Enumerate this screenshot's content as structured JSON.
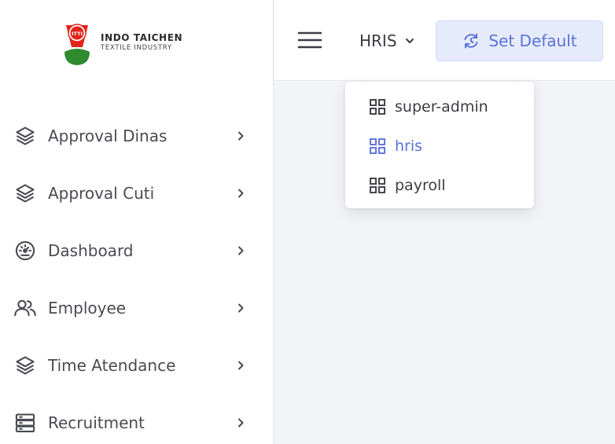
{
  "brand": {
    "name": "INDO TAICHEN",
    "subtitle": "TEXTILE INDUSTRY",
    "badge": "ITTI"
  },
  "sidebar": {
    "items": [
      {
        "label": "Approval Dinas",
        "icon": "layers-icon"
      },
      {
        "label": "Approval Cuti",
        "icon": "layers-icon"
      },
      {
        "label": "Dashboard",
        "icon": "gauge-icon"
      },
      {
        "label": "Employee",
        "icon": "users-icon"
      },
      {
        "label": "Time Atendance",
        "icon": "layers-icon"
      },
      {
        "label": "Recruitment",
        "icon": "server-icon"
      }
    ]
  },
  "header": {
    "module_select": "HRIS",
    "set_default_label": "Set Default"
  },
  "dropdown": {
    "items": [
      {
        "label": "super-admin",
        "active": false
      },
      {
        "label": "hris",
        "active": true
      },
      {
        "label": "payroll",
        "active": false
      }
    ]
  },
  "colors": {
    "accent": "#5b72d8",
    "accent_bg": "#e6ebfc",
    "text": "#3c3d44",
    "logo_red": "#e2231a",
    "logo_green": "#2e8b2e"
  }
}
